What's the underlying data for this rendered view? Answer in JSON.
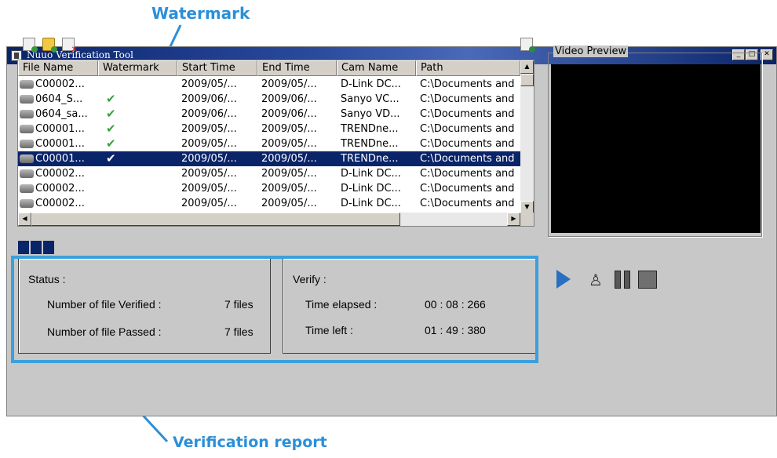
{
  "annotations": {
    "watermark": "Watermark",
    "report": "Verification report"
  },
  "window": {
    "title": "Nuuo Verification Tool"
  },
  "toolbar": {
    "icons": [
      "add-file-icon",
      "add-folder-icon",
      "remove-file-icon",
      "export-icon"
    ]
  },
  "list": {
    "columns": [
      "File Name",
      "Watermark",
      "Start Time",
      "End Time",
      "Cam Name",
      "Path"
    ],
    "rows": [
      {
        "file": "C00002...",
        "watermark": "",
        "start": "2009/05/...",
        "end": "2009/05/...",
        "cam": "D-Link DC...",
        "path": "C:\\Documents and"
      },
      {
        "file": "0604_S...",
        "watermark": "✔",
        "start": "2009/06/...",
        "end": "2009/06/...",
        "cam": "Sanyo VC...",
        "path": "C:\\Documents and"
      },
      {
        "file": "0604_sa...",
        "watermark": "✔",
        "start": "2009/06/...",
        "end": "2009/06/...",
        "cam": "Sanyo VD...",
        "path": "C:\\Documents and"
      },
      {
        "file": "C00001...",
        "watermark": "✔",
        "start": "2009/05/...",
        "end": "2009/05/...",
        "cam": "TRENDne...",
        "path": "C:\\Documents and"
      },
      {
        "file": "C00001...",
        "watermark": "✔",
        "start": "2009/05/...",
        "end": "2009/05/...",
        "cam": "TRENDne...",
        "path": "C:\\Documents and"
      },
      {
        "file": "C00001...",
        "watermark": "✔",
        "start": "2009/05/...",
        "end": "2009/05/...",
        "cam": "TRENDne...",
        "path": "C:\\Documents and"
      },
      {
        "file": "C00002...",
        "watermark": "",
        "start": "2009/05/...",
        "end": "2009/05/...",
        "cam": "D-Link DC...",
        "path": "C:\\Documents and"
      },
      {
        "file": "C00002...",
        "watermark": "",
        "start": "2009/05/...",
        "end": "2009/05/...",
        "cam": "D-Link DC...",
        "path": "C:\\Documents and"
      },
      {
        "file": "C00002...",
        "watermark": "",
        "start": "2009/05/...",
        "end": "2009/05/...",
        "cam": "D-Link DC...",
        "path": "C:\\Documents and"
      }
    ],
    "selected_row": 5
  },
  "progress": {
    "blocks_filled": 3
  },
  "status": {
    "heading": "Status :",
    "verified_label": "Number of file Verified :",
    "verified_value": "7  files",
    "passed_label": "Number of file Passed :",
    "passed_value": "7  files"
  },
  "verify": {
    "heading": "Verify :",
    "elapsed_label": "Time elapsed :",
    "elapsed_value": "00 : 08 : 266",
    "left_label": "Time left :",
    "left_value": "01 : 49 : 380"
  },
  "preview": {
    "label": "Video Preview"
  },
  "colors": {
    "annotation": "#2b8fd8",
    "titlebar": "#0a246a",
    "selection": "#0a246a",
    "check": "#3aa040",
    "play": "#2a6fc0"
  }
}
